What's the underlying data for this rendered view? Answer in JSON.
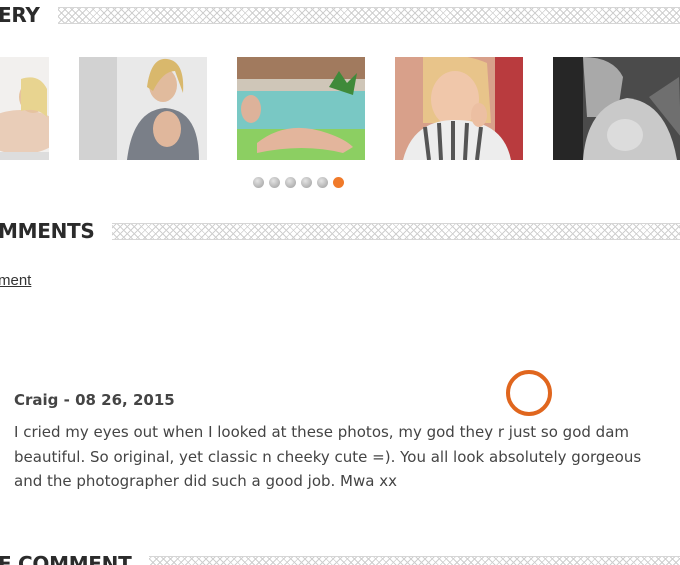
{
  "gallery": {
    "heading": "ERY",
    "thumbnails": [
      {
        "alt": "photo-1"
      },
      {
        "alt": "photo-2"
      },
      {
        "alt": "photo-3"
      },
      {
        "alt": "photo-4"
      },
      {
        "alt": "photo-5"
      }
    ],
    "pagination": {
      "count": 6,
      "active_index": 5
    }
  },
  "comments": {
    "heading": "MMENTS",
    "add_link": "ment",
    "items": [
      {
        "meta": "Craig - 08 26, 2015",
        "body": "I cried my eyes out when I looked at these photos, my god they r just so god dam beautiful. So original, yet classic n cheeky cute =). You all look absolutely gorgeous and the photographer did such a good job. Mwa xx"
      }
    ]
  },
  "leave_comment": {
    "heading": "E COMMENT"
  },
  "colors": {
    "accent": "#f07a2a",
    "cursor_ring": "#e0661e",
    "text": "#444444",
    "heading": "#2b2b2b"
  }
}
